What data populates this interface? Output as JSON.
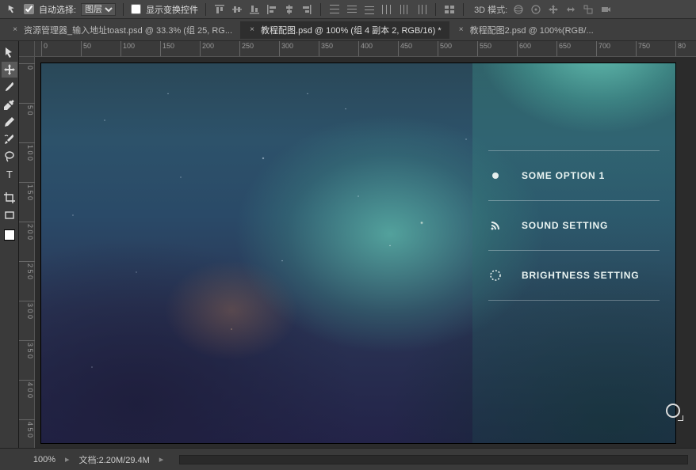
{
  "toolbar": {
    "auto_select_label": "自动选择:",
    "auto_select_dropdown": "图层",
    "show_transform_label": "显示变换控件",
    "mode3d_label": "3D 模式:"
  },
  "tabs": [
    {
      "label": "资源管理器_输入地址toast.psd @ 33.3% (组 25, RG...",
      "active": false
    },
    {
      "label": "教程配图.psd @ 100% (组 4 副本 2, RGB/16) *",
      "active": true
    },
    {
      "label": "教程配图2.psd @ 100%(RGB/...",
      "active": false
    }
  ],
  "ruler_h": [
    "0",
    "50",
    "100",
    "150",
    "200",
    "250",
    "300",
    "350",
    "400",
    "450",
    "500",
    "550",
    "600",
    "650",
    "700",
    "750",
    "80"
  ],
  "ruler_v": [
    "0",
    "5",
    "0",
    "1",
    "0",
    "0",
    "1",
    "5",
    "0",
    "2",
    "0",
    "0",
    "2",
    "5",
    "0",
    "3",
    "0",
    "0",
    "3",
    "5",
    "0",
    "4",
    "0",
    "0",
    "4",
    "5",
    "0"
  ],
  "ruler_v_marks": [
    0,
    50,
    100,
    150,
    200,
    250,
    300,
    350,
    400,
    450
  ],
  "ui_options": [
    {
      "icon": "dot",
      "label": "SOME OPTION 1"
    },
    {
      "icon": "rss",
      "label": "SOUND SETTING"
    },
    {
      "icon": "brightness",
      "label": "BRIGHTNESS SETTING"
    }
  ],
  "status": {
    "zoom": "100%",
    "doc_label": "文档:2.20M/29.4M"
  }
}
